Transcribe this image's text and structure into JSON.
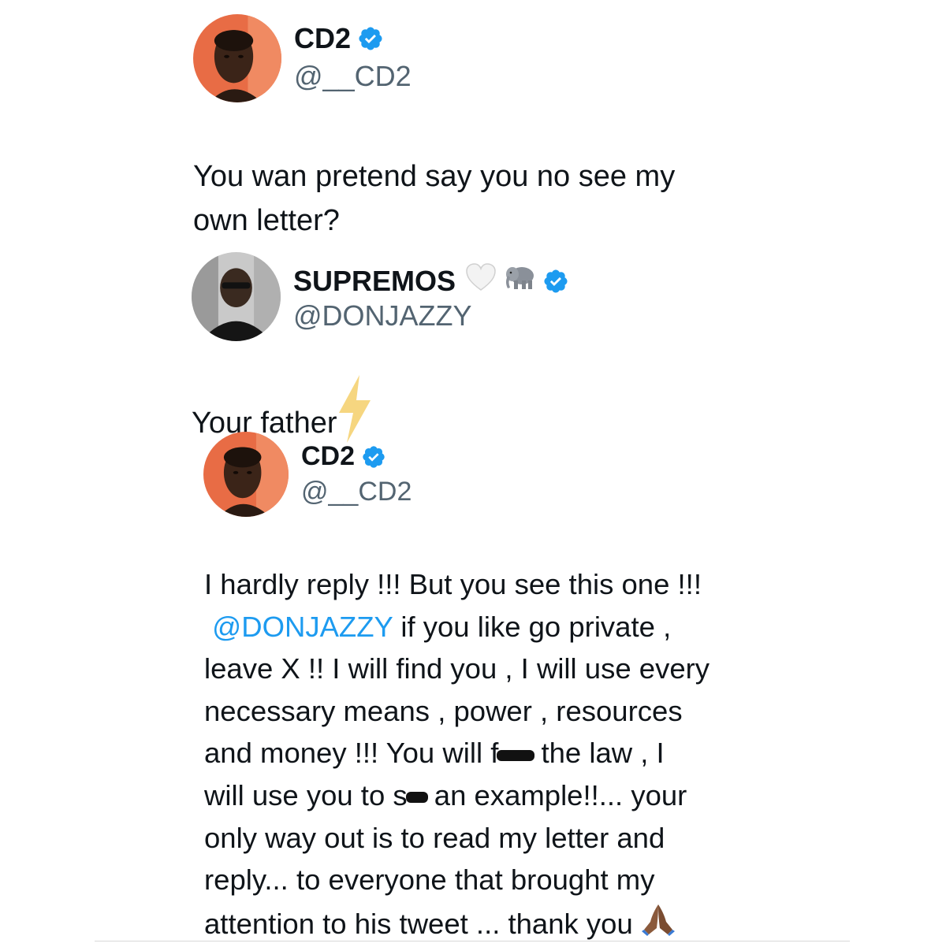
{
  "tweet1": {
    "name": "CD2",
    "handle": "@__CD2",
    "text_lines": [
      "You wan pretend say you no see my",
      "own letter?"
    ],
    "verified": true
  },
  "tweet2": {
    "name": "SUPREMOS",
    "name_emojis": [
      "white-heart-icon",
      "elephant-icon"
    ],
    "handle": "@DONJAZZY",
    "text": "Your father",
    "trailing_emoji": "lightning-icon",
    "verified": true
  },
  "tweet3": {
    "name": "CD2",
    "handle": "@__CD2",
    "verified": true,
    "line1": "I hardly reply !!! But you see this one !!!",
    "mention": "@DONJAZZY",
    "line2_rest": " if you like go private ,",
    "line3": "leave X !! I will find you , I will use every",
    "line4": "necessary means , power , resources",
    "line5_a": "and money !!!  You will f",
    "line5_b": " the law , I",
    "line6_a": "will use you to s",
    "line6_b": " an example!!... your",
    "line7": "only way out is to read my letter and",
    "line8": "reply... to everyone that brought my",
    "line9": "attention to his tweet ... thank you",
    "trailing_emoji": "praying-hands-icon"
  },
  "colors": {
    "verified_blue": "#1d9bf0",
    "mention_blue": "#1d9bf0",
    "handle_gray": "#536471",
    "avatar_orange": "#e8704a"
  }
}
